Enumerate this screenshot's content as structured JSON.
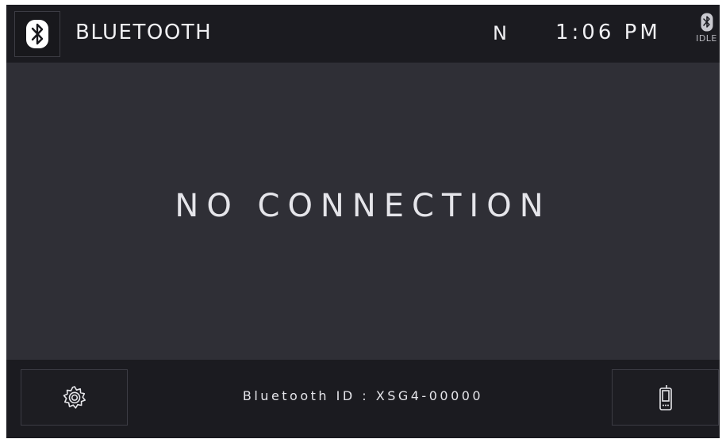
{
  "header": {
    "title": "BLUETOOTH",
    "gear": "N",
    "time": "1:06 PM",
    "status_label": "IDLE",
    "bluetooth_icon": "bluetooth-icon"
  },
  "main": {
    "message": "NO CONNECTION"
  },
  "footer": {
    "bluetooth_id": "Bluetooth ID : XSG4-00000",
    "settings_icon": "gear-icon",
    "device_icon": "phone-icon"
  },
  "colors": {
    "background": "#2f2f36",
    "bar": "#1b1b20",
    "text": "#e6e6ea"
  }
}
